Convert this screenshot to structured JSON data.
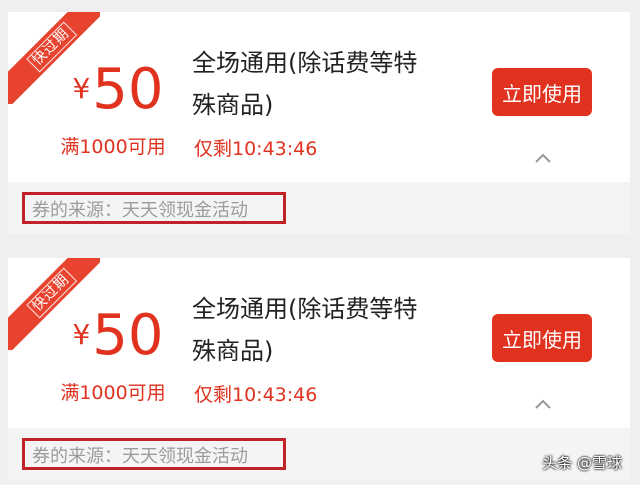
{
  "coupons": [
    {
      "badge": "快过期",
      "currency": "¥",
      "amount": "50",
      "condition": "满1000可用",
      "title_line1": "全场通用(除话费等特",
      "title_line2": "殊商品)",
      "remaining": "仅剩10:43:46",
      "action": "立即使用",
      "source": "券的来源：天天领现金活动"
    },
    {
      "badge": "快过期",
      "currency": "¥",
      "amount": "50",
      "condition": "满1000可用",
      "title_line1": "全场通用(除话费等特",
      "title_line2": "殊商品)",
      "remaining": "仅剩10:43:46",
      "action": "立即使用",
      "source": "券的来源：天天领现金活动"
    }
  ],
  "watermark": "头条 @雪球",
  "colors": {
    "accent": "#e0321f",
    "highlight_border": "#c1222a",
    "background": "#efefef"
  }
}
